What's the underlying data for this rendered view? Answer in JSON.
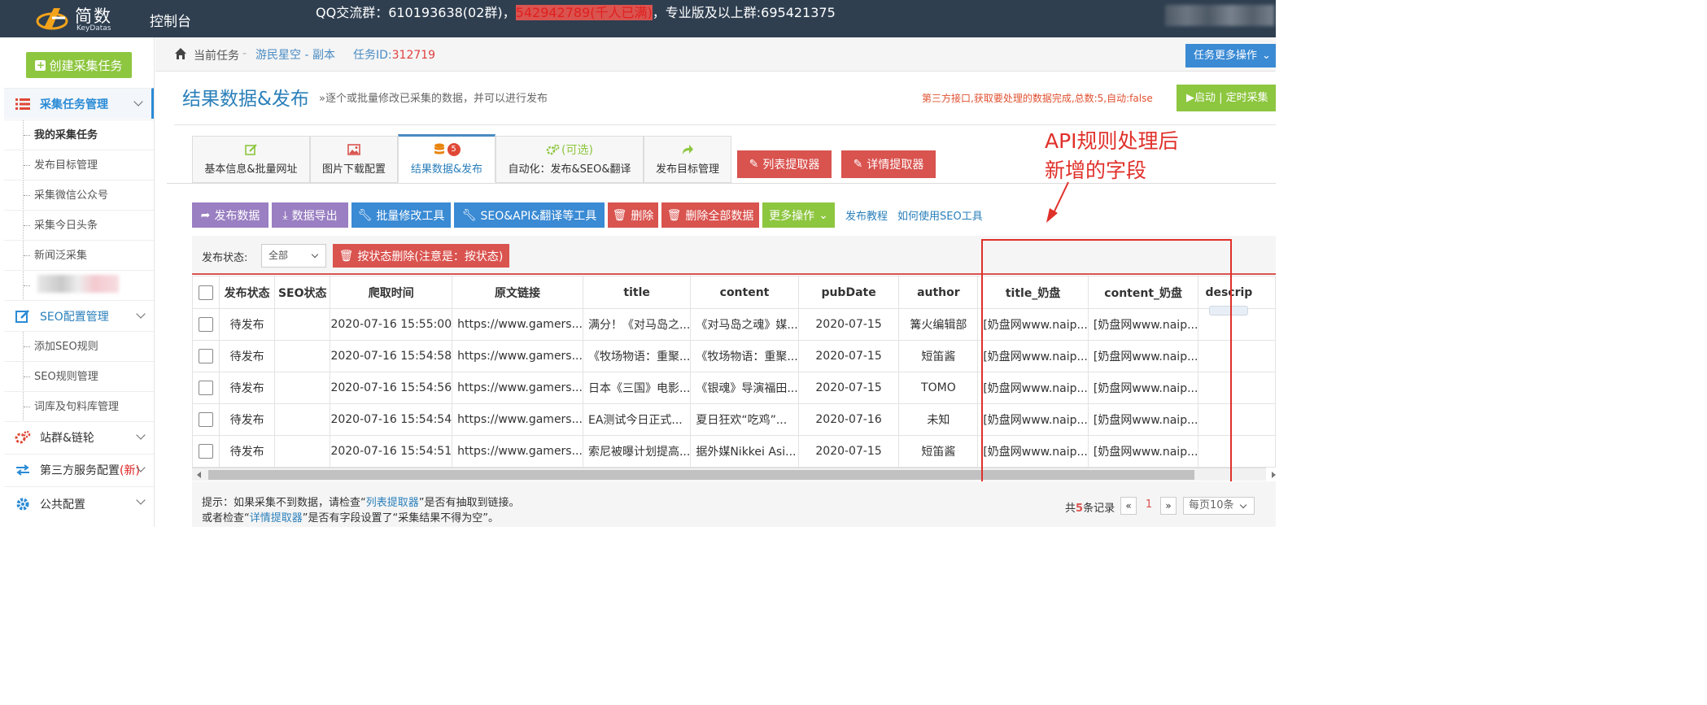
{
  "header": {
    "logo_name": "简数",
    "logo_sub": "KeyDatas",
    "console": "控制台",
    "qq_prefix": "QQ交流群：610193638(02群)，",
    "qq_red": "542942789(千人已满)",
    "qq_suffix": "，专业版及以上群:695421375"
  },
  "sidebar": {
    "create_label": "创建采集任务",
    "sec_collect": "采集任务管理",
    "items_collect": [
      "我的采集任务",
      "发布目标管理",
      "采集微信公众号",
      "采集今日头条",
      "新闻泛采集"
    ],
    "sec_seo": "SEO配置管理",
    "items_seo": [
      "添加SEO规则",
      "SEO规则管理",
      "词库及句料库管理"
    ],
    "sec_station": "站群&链轮",
    "sec_third": "第三方服务配置",
    "sec_third_new": "(新)",
    "sec_public": "公共配置"
  },
  "breadcrumb": {
    "current": "当前任务",
    "sep": "-",
    "task_name": "游民星空 - 副本",
    "task_id_label": "任务ID:",
    "task_id": "312719",
    "more_ops": "任务更多操作"
  },
  "page": {
    "title": "结果数据&发布",
    "subtitle": "»逐个或批量修改已采集的数据，并可以进行发布",
    "api_notice": "第三方接口,获取要处理的数据完成,总数:5,自动:false",
    "start_button": "▶启动 | 定时采集"
  },
  "tabs": [
    {
      "label": "基本信息&批量网址"
    },
    {
      "label": "图片下载配置"
    },
    {
      "label": "结果数据&发布",
      "badge": "5"
    },
    {
      "label": "自动化：发布&SEO&翻译",
      "top": "(可选)"
    },
    {
      "label": "发布目标管理"
    }
  ],
  "extractors": {
    "list": "列表提取器",
    "detail": "详情提取器"
  },
  "annotation": {
    "line1": "API规则处理后",
    "line2": "新增的字段"
  },
  "toolbar": {
    "publish": "发布数据",
    "export": "数据导出",
    "batch_edit": "批量修改工具",
    "seo_tools": "SEO&API&翻译等工具",
    "delete": "删除",
    "delete_all": "删除全部数据",
    "more": "更多操作",
    "link_tutorial": "发布教程",
    "link_seo": "如何使用SEO工具"
  },
  "filter": {
    "label": "发布状态:",
    "selected": "全部",
    "delete_by_status": "按状态删除(注意是：按状态)"
  },
  "table": {
    "headers": [
      "发布状态",
      "SEO状态",
      "爬取时间",
      "原文链接",
      "title",
      "content",
      "pubDate",
      "author",
      "title_奶盘",
      "content_奶盘",
      "descrip"
    ],
    "rows": [
      [
        "待发布",
        "",
        "2020-07-16 15:55:00",
        "https://www.gamers...",
        "满分！《对马岛之...",
        "《对马岛之魂》媒...",
        "2020-07-15",
        "篝火编辑部",
        "[奶盘网www.naip...",
        "[奶盘网www.naip..."
      ],
      [
        "待发布",
        "",
        "2020-07-16 15:54:58",
        "https://www.gamers...",
        "《牧场物语：重聚...",
        "《牧场物语：重聚...",
        "2020-07-15",
        "短笛酱",
        "[奶盘网www.naip...",
        "[奶盘网www.naip..."
      ],
      [
        "待发布",
        "",
        "2020-07-16 15:54:56",
        "https://www.gamers...",
        "日本《三国》电影...",
        "《银魂》导演福田...",
        "2020-07-15",
        "TOMO",
        "[奶盘网www.naip...",
        "[奶盘网www.naip..."
      ],
      [
        "待发布",
        "",
        "2020-07-16 15:54:54",
        "https://www.gamers...",
        "EA测试今日正式...",
        "夏日狂欢“吃鸡”...",
        "2020-07-16",
        "未知",
        "[奶盘网www.naip...",
        "[奶盘网www.naip..."
      ],
      [
        "待发布",
        "",
        "2020-07-16 15:54:51",
        "https://www.gamers...",
        "索尼被曝计划提高...",
        "据外媒Nikkei Asi...",
        "2020-07-15",
        "短笛酱",
        "[奶盘网www.naip...",
        "[奶盘网www.naip..."
      ]
    ]
  },
  "footer": {
    "tip1_a": "提示：如果采集不到数据，请检查“",
    "tip1_link": "列表提取器",
    "tip1_b": "”是否有抽取到链接。",
    "tip2_a": "或者检查“",
    "tip2_link": "详情提取器",
    "tip2_b": "”是否有字段设置了“采集结果不得为空”。",
    "total_a": "共",
    "total_n": "5",
    "total_b": "条记录",
    "prev": "«",
    "page": "1",
    "next": "»",
    "page_size": "每页10条"
  },
  "colors": {
    "header_bg": "#2f3f50",
    "accent_blue": "#3a8ad4",
    "green": "#8dc63f",
    "red": "#d9534f",
    "purple": "#9a7fc2",
    "annotation_red": "#e0302a"
  }
}
